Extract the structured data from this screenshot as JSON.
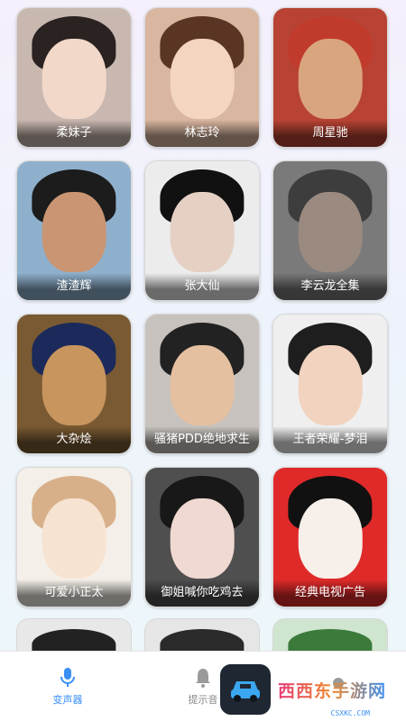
{
  "grid": {
    "cards": [
      {
        "label": "柔妹子",
        "bg": "#c9b8b0",
        "hair": "#2b2222",
        "skin": "#f2d8c8"
      },
      {
        "label": "林志玲",
        "bg": "#d9b6a0",
        "hair": "#5a3524",
        "skin": "#f4d6c0"
      },
      {
        "label": "周星驰",
        "bg": "#b84334",
        "hair": "#c13b2c",
        "skin": "#d9a57e"
      },
      {
        "label": "渣渣辉",
        "bg": "#8fb0cc",
        "hair": "#1c1c1c",
        "skin": "#c99572"
      },
      {
        "label": "张大仙",
        "bg": "#ececec",
        "hair": "#111111",
        "skin": "#e5d0c3"
      },
      {
        "label": "李云龙全集",
        "bg": "#7a7a7a",
        "hair": "#3d3d3d",
        "skin": "#9a8a80"
      },
      {
        "label": "大杂烩",
        "bg": "#7a5a32",
        "hair": "#1b2a5a",
        "skin": "#c8955f"
      },
      {
        "label": "骚猪PDD绝地求生",
        "bg": "#c7c2bd",
        "hair": "#222222",
        "skin": "#e5c0a0"
      },
      {
        "label": "王者荣耀-梦泪",
        "bg": "#efefef",
        "hair": "#1e1e1e",
        "skin": "#f1d3bf"
      },
      {
        "label": "可爱小正太",
        "bg": "#f4efe8",
        "hair": "#d7b08a",
        "skin": "#f7e3d2"
      },
      {
        "label": "御姐喊你吃鸡去",
        "bg": "#4f4f4f",
        "hair": "#181818",
        "skin": "#f0d9d2"
      },
      {
        "label": "经典电视广告",
        "bg": "#e02a2a",
        "hair": "#111111",
        "skin": "#f7f0ea"
      }
    ]
  },
  "partial_row": [
    {
      "bg": "#e8e8e8",
      "hair": "#222222"
    },
    {
      "bg": "#e6e6e6",
      "hair": "#2b2b2b"
    },
    {
      "bg": "#cfe5cf",
      "hair": "#3b7a3b"
    }
  ],
  "tabbar": {
    "tabs": [
      {
        "label": "变声器",
        "icon": "mic-icon",
        "active": true
      },
      {
        "label": "提示音",
        "icon": "bell-icon",
        "active": false
      },
      {
        "label": "",
        "icon": "car-icon",
        "active": false
      }
    ]
  },
  "watermark": {
    "text": "西西东手游网",
    "sub": "CSXKC.COM"
  },
  "colors": {
    "accent": "#3a8ff5",
    "inactive": "#888888"
  }
}
